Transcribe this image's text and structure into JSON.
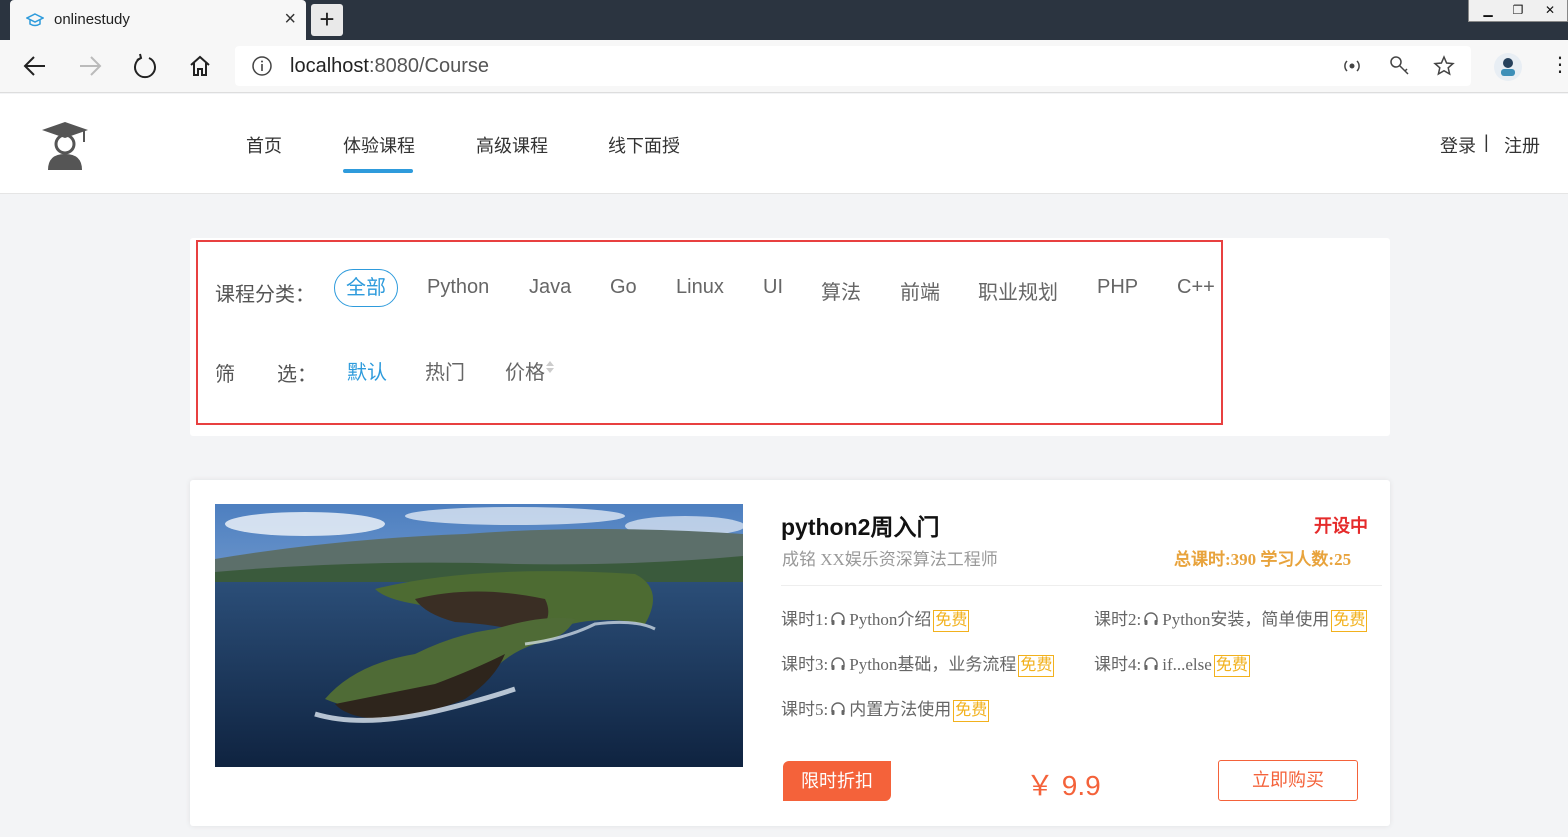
{
  "browser": {
    "tab_title": "onlinestudy",
    "tab_close": "×",
    "new_tab": "+",
    "address_host": "localhost",
    "address_rest": ":8080/Course",
    "more": "⋮"
  },
  "site": {
    "nav": [
      "首页",
      "体验课程",
      "高级课程",
      "线下面授"
    ],
    "active_nav": "体验课程",
    "login": "登录",
    "separator": "|",
    "register": "注册"
  },
  "filter": {
    "category_label": "课程分类：",
    "categories": [
      "全部",
      "Python",
      "Java",
      "Go",
      "Linux",
      "UI",
      "算法",
      "前端",
      "职业规划",
      "PHP",
      "C++"
    ],
    "sort_label_1": "筛",
    "sort_label_2": "选：",
    "sorts": [
      "默认",
      "热门",
      "价格"
    ]
  },
  "course": {
    "title": "python2周入门",
    "status": "开设中",
    "teacher": "成铭 XX娱乐资深算法工程师",
    "stats": "总课时:390 学习人数:25",
    "lessons": [
      {
        "num": "课时1:",
        "name": "Python介绍",
        "tag": "免费"
      },
      {
        "num": "课时2:",
        "name": "Python安装，简单使用",
        "tag": "免费"
      },
      {
        "num": "课时3:",
        "name": "Python基础，业务流程",
        "tag": "免费"
      },
      {
        "num": "课时4:",
        "name": "if...else",
        "tag": "免费"
      },
      {
        "num": "课时5:",
        "name": "内置方法使用",
        "tag": "免费"
      }
    ],
    "discount": "限时折扣",
    "price": "￥ 9.9",
    "buy": "立即购买"
  },
  "colors": {
    "accent": "#2e9bdc",
    "price": "#f4623a",
    "status": "#e52b2b",
    "stats": "#e8a33c",
    "free_tag": "#f2b11d",
    "outline": "#e84040"
  }
}
